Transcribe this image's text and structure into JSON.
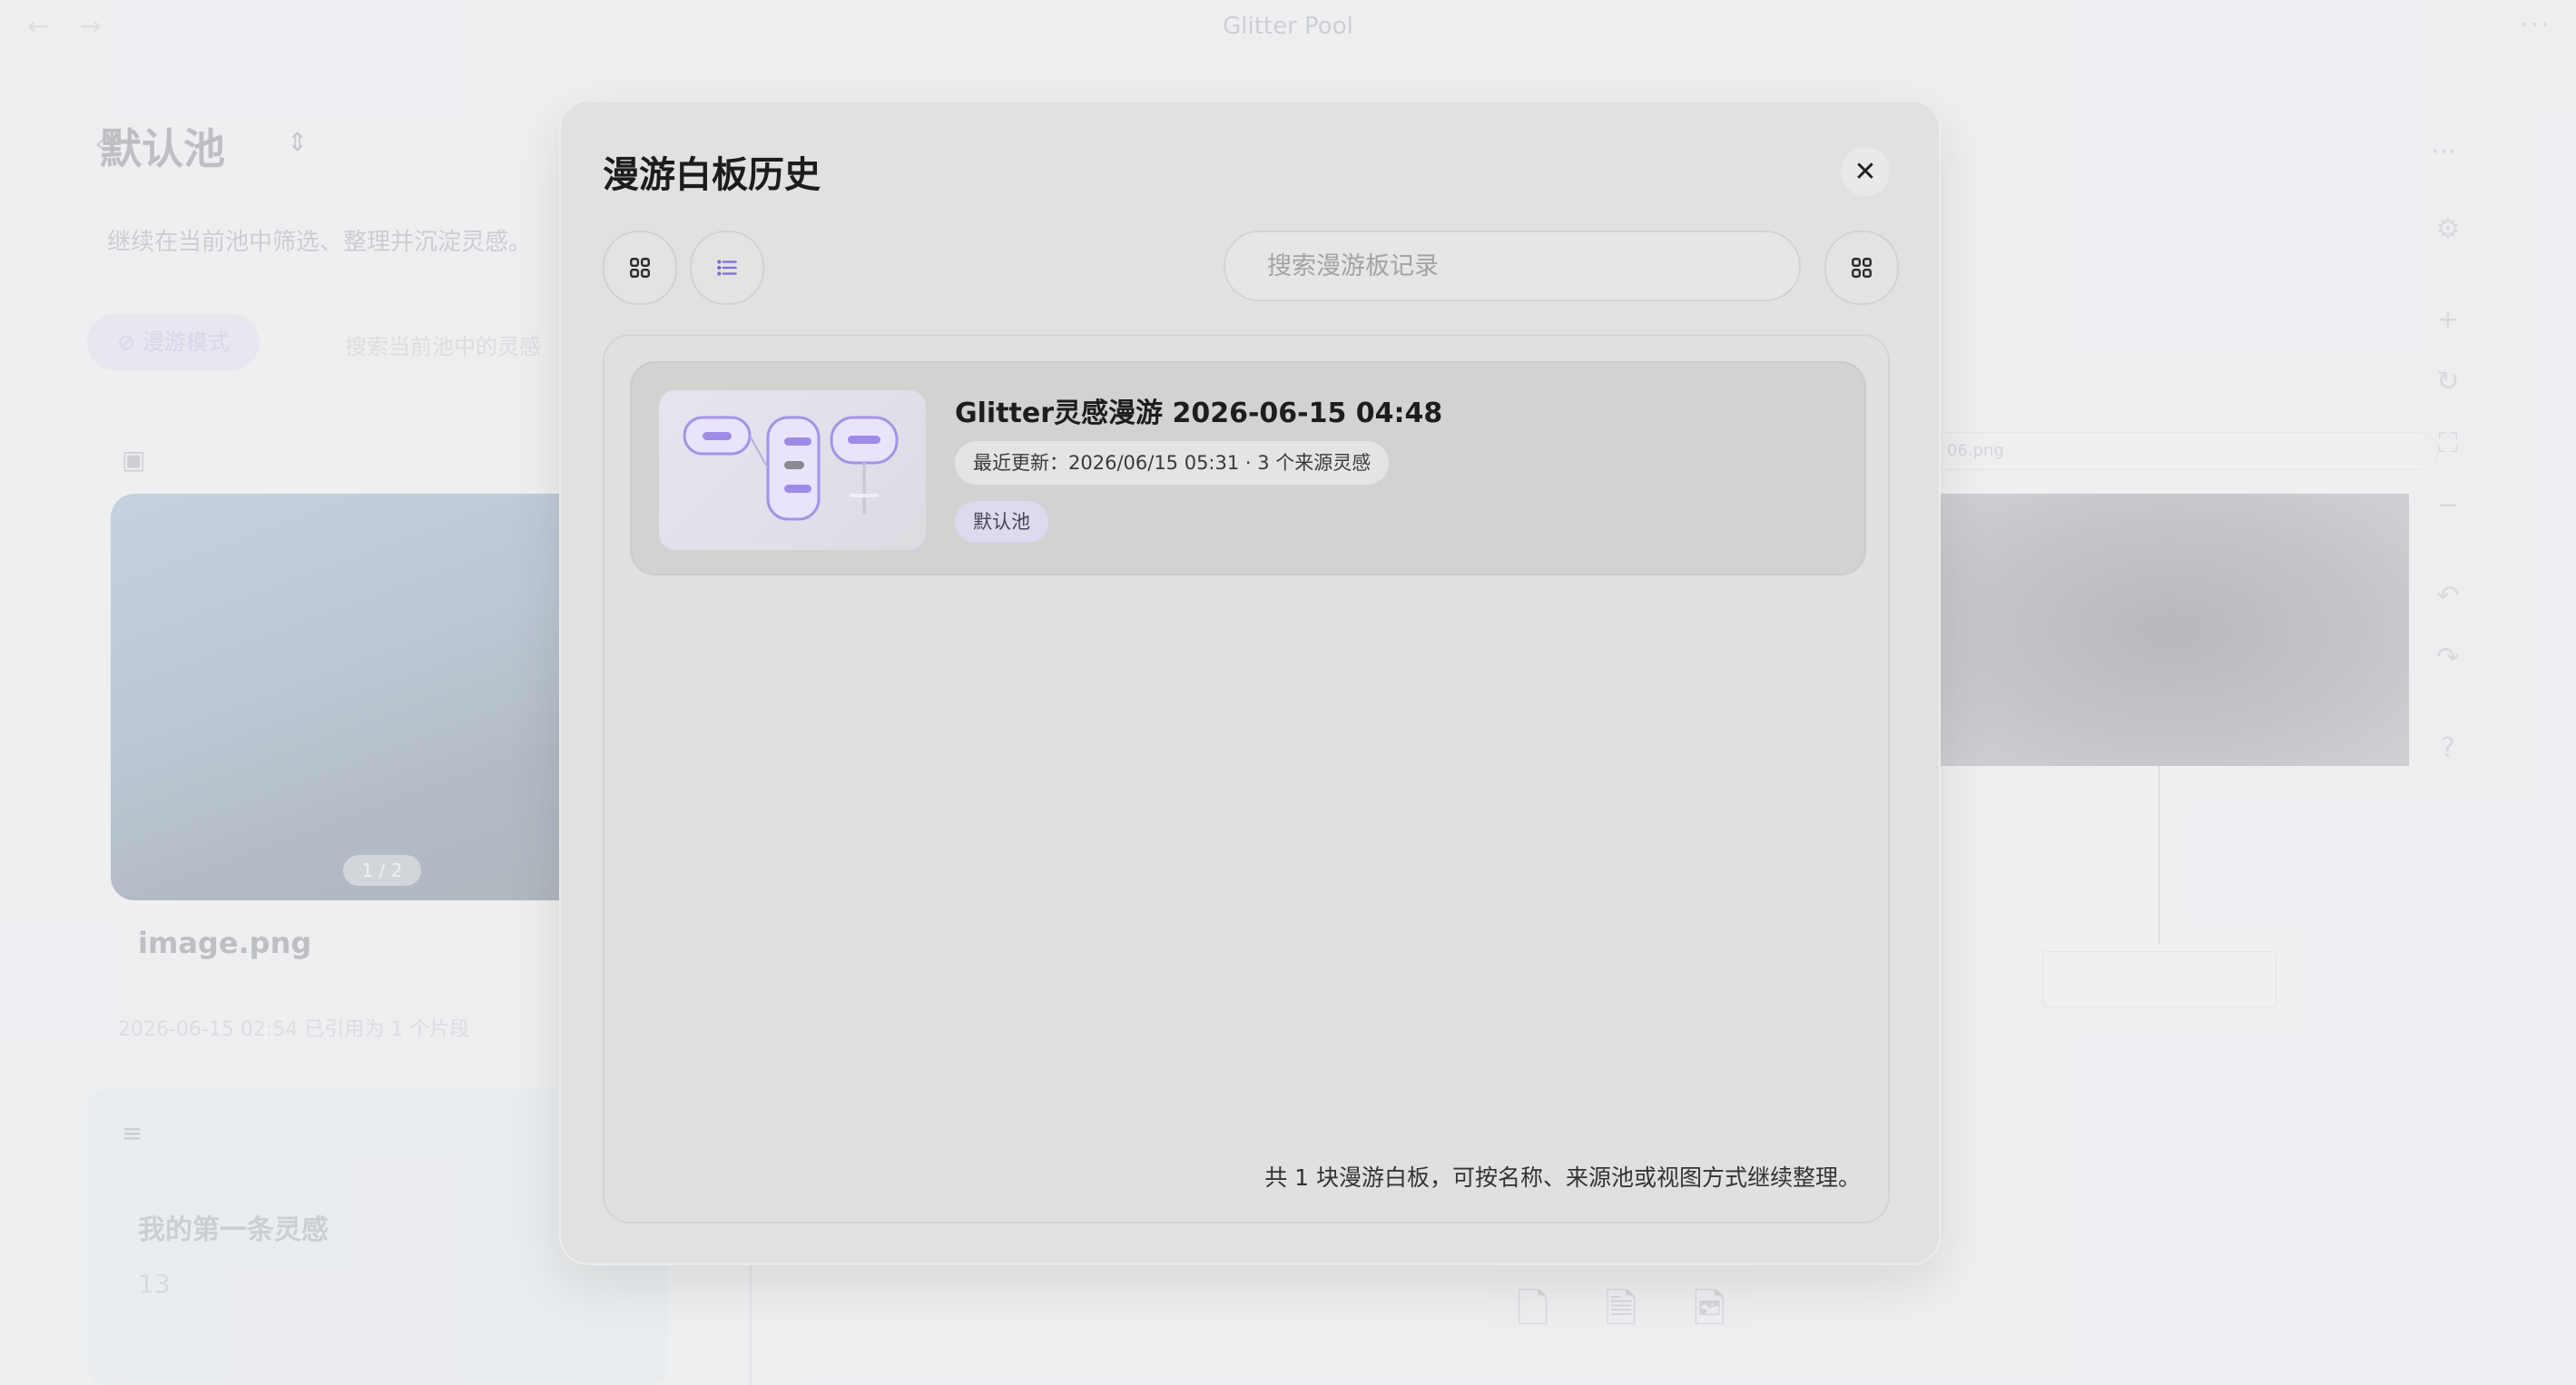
{
  "window": {
    "title": "Glitter Pool",
    "back_icon": "arrow-left-icon",
    "forward_icon": "arrow-right-icon",
    "menu_icon": "ellipsis-icon"
  },
  "background": {
    "pool_title": "默认池",
    "pool_subtitle": "继续在当前池中筛选、整理并沉淀灵感。",
    "roam_mode_label": "漫游模式",
    "search_placeholder": "搜索当前池中的灵感",
    "image_item": {
      "counter": "1 / 2",
      "name": "image.png",
      "meta": "2026-06-15 02:54  已引用为 1 个片段"
    },
    "note_item": {
      "title": "我的第一条灵感",
      "count": "13"
    },
    "whiteboard_url": "06.png"
  },
  "dialog": {
    "title": "漫游白板历史",
    "close_icon": "close-icon",
    "search_placeholder": "搜索漫游板记录",
    "grid_view_icon": "grid-view-icon",
    "list_view_icon": "list-view-icon",
    "layout_icon": "grid-layout-icon",
    "accent_color": "#7b6cd9",
    "records": [
      {
        "title": "Glitter灵感漫游 2026-06-15 04:48",
        "meta": "最近更新：2026/06/15 05:31 · 3 个来源灵感",
        "pool": "默认池"
      }
    ],
    "footer": "共 1 块漫游白板，可按名称、来源池或视图方式继续整理。"
  }
}
